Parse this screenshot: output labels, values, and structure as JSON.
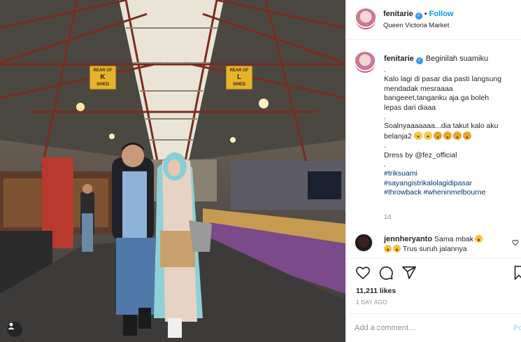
{
  "post": {
    "header": {
      "username": "fenitarie",
      "follow_label": "Follow",
      "dot": "•",
      "location": "Queen Victoria Market"
    },
    "photo": {
      "sign_left": [
        "REAR OF",
        "K",
        "SHED"
      ],
      "sign_right": [
        "REAR OF",
        "L",
        "SHED"
      ]
    },
    "caption": {
      "username": "fenitarie",
      "title": "Beginilah suamiku",
      "lines": [
        ".",
        "Kalo lagi di pasar dia pasti langsung",
        "mendadak mesraaaa",
        "bangeeet,tanganku aja ga boleh",
        "lepas dari diaaa",
        ".",
        "Soalnyaaaaaaa...dia takut kalo aku",
        "belanja2",
        ".",
        "Dress by @fez_official",
        ".",
        "#triksuami",
        "#sayangistrikalolagidipasar",
        "#throwback #wheninmelbourne"
      ],
      "time": "1d"
    },
    "comment": {
      "username": "jennheryanto",
      "text": "Sama mbak",
      "reply": "Trus suruh jalannya"
    },
    "likes": "11,211 likes",
    "posted": "1 DAY AGO",
    "add_comment": {
      "placeholder": "Add a comment…",
      "post_label": "Po"
    },
    "icons": [
      "heart-icon",
      "comment-icon",
      "share-icon",
      "bookmark-icon",
      "verified-icon",
      "user-tag-icon"
    ],
    "colors": {
      "link": "#0095f6",
      "hashtag": "#00376b",
      "verified": "#3897f0",
      "muted": "#8e8e8e"
    }
  }
}
